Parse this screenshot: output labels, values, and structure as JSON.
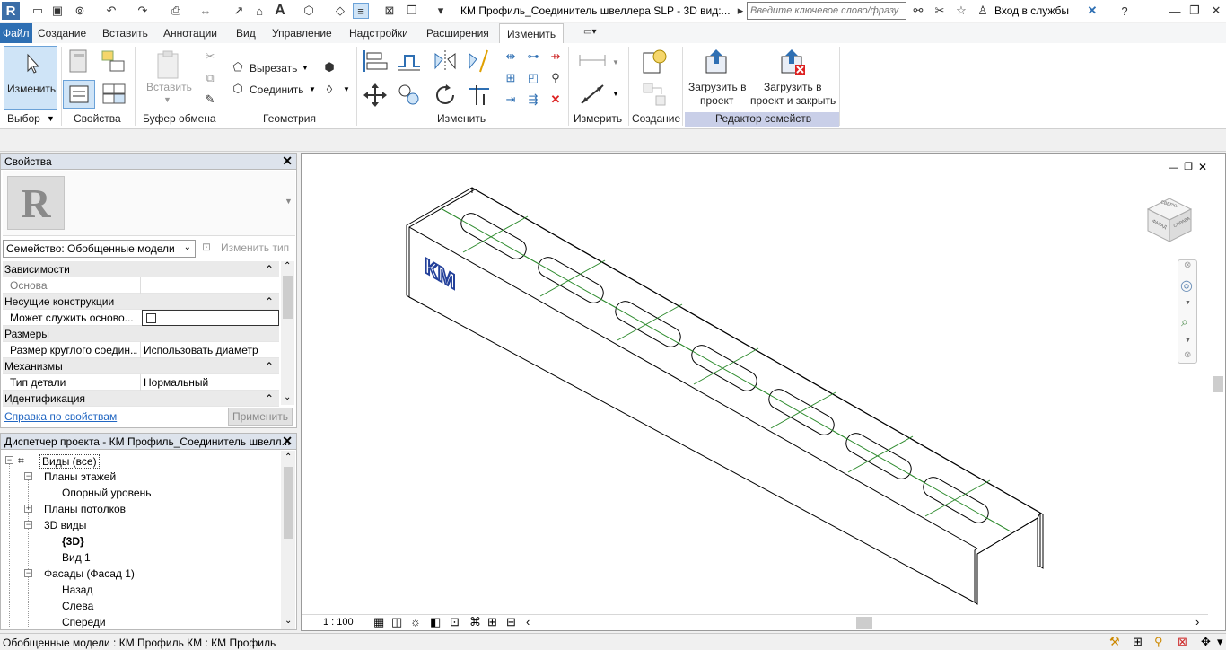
{
  "title": "КМ Профиль_Соединитель швеллера SLP - 3D вид:...",
  "search": {
    "placeholder": "Введите ключевое слово/фразу"
  },
  "login_label": "Вход в службы",
  "tabs": [
    {
      "label": "Файл"
    },
    {
      "label": "Создание"
    },
    {
      "label": "Вставить"
    },
    {
      "label": "Аннотации"
    },
    {
      "label": "Вид"
    },
    {
      "label": "Управление"
    },
    {
      "label": "Надстройки"
    },
    {
      "label": "Расширения"
    },
    {
      "label": "Изменить"
    }
  ],
  "ribbon": {
    "modify_button": "Изменить",
    "paste_button": "Вставить",
    "cut_label": "Вырезать",
    "join_label": "Соединить",
    "load_project_1": "Загрузить в",
    "load_project_2": "проект",
    "load_close_1": "Загрузить в",
    "load_close_2": "проект и закрыть",
    "panels": {
      "select": "Выбор",
      "properties": "Свойства",
      "clipboard": "Буфер обмена",
      "geometry": "Геометрия",
      "modify": "Изменить",
      "measure": "Измерить",
      "create": "Создание",
      "family_editor": "Редактор семейств"
    }
  },
  "properties": {
    "header": "Свойства",
    "type_selector": "Семейство: Обобщенные модели",
    "edit_type": "Изменить тип",
    "rows": [
      {
        "name": "Зависимости",
        "value": "",
        "category": true
      },
      {
        "name": "Основа",
        "value": "",
        "category": false
      },
      {
        "name": "Несущие конструкции",
        "value": "",
        "category": true
      },
      {
        "name": "Может служить осново...",
        "value": "",
        "category": false
      },
      {
        "name": "Размеры",
        "value": "",
        "category": true
      },
      {
        "name": "Размер круглого соедин...",
        "value": "Использовать диаметр",
        "category": false
      },
      {
        "name": "Механизмы",
        "value": "",
        "category": true
      },
      {
        "name": "Тип детали",
        "value": "Нормальный",
        "category": false
      },
      {
        "name": "Идентификация",
        "value": "",
        "category": true
      }
    ],
    "help_link": "Справка по свойствам",
    "apply_button": "Применить"
  },
  "browser": {
    "header": "Диспетчер проекта - КМ Профиль_Соединитель швелл...",
    "nodes": [
      {
        "label": "Виды (все)"
      },
      {
        "label": "Планы этажей"
      },
      {
        "label": "Опорный уровень"
      },
      {
        "label": "Планы потолков"
      },
      {
        "label": "3D виды"
      },
      {
        "label": "{3D}"
      },
      {
        "label": "Вид 1"
      },
      {
        "label": "Фасады (Фасад 1)"
      },
      {
        "label": "Назад"
      },
      {
        "label": "Слева"
      },
      {
        "label": "Спереди"
      }
    ]
  },
  "viewport": {
    "logo_text": "КМ",
    "scale": "1 : 100",
    "viewcube_faces": [
      "СВЕРХУ",
      "ФАСАД",
      "СПРАВА"
    ]
  },
  "status": {
    "text": "Обобщенные модели : КМ Профиль КМ : КМ Профиль"
  },
  "colors": {
    "accent": "#2e6fb3",
    "selected": "#cfe4f7",
    "green_lines": "#2e8b2e"
  }
}
